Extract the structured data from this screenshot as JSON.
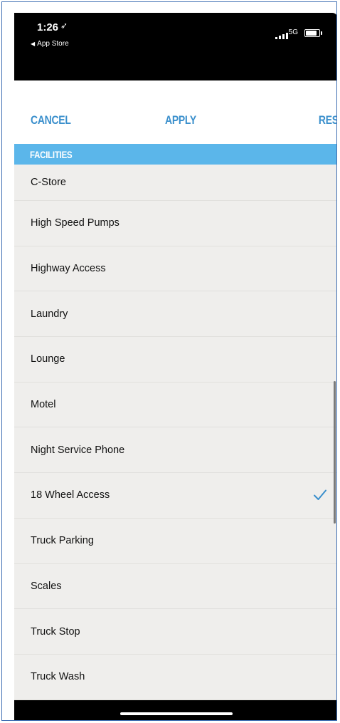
{
  "status_bar": {
    "time": "1:26",
    "location_icon": "location-arrow-icon",
    "back_app": "App Store",
    "network": "5G",
    "signal": "signal-bars-icon",
    "battery": "battery-icon"
  },
  "actions": {
    "cancel_label": "CANCEL",
    "apply_label": "APPLY",
    "reset_label": "RESET"
  },
  "section_title": "FACILITIES",
  "items": [
    {
      "label": "C-Store",
      "checked": false
    },
    {
      "label": "High Speed Pumps",
      "checked": false
    },
    {
      "label": "Highway Access",
      "checked": false
    },
    {
      "label": "Laundry",
      "checked": false
    },
    {
      "label": "Lounge",
      "checked": false
    },
    {
      "label": "Motel",
      "checked": false
    },
    {
      "label": "Night Service Phone",
      "checked": false
    },
    {
      "label": "18 Wheel Access",
      "checked": true
    },
    {
      "label": "Truck Parking",
      "checked": false
    },
    {
      "label": "Scales",
      "checked": false
    },
    {
      "label": "Truck Stop",
      "checked": false
    },
    {
      "label": "Truck Wash",
      "checked": false
    }
  ],
  "colors": {
    "accent": "#3a8fcc",
    "section_bg": "#5bb6ea",
    "list_bg": "#efeeec",
    "check": "#3a8fcc"
  }
}
